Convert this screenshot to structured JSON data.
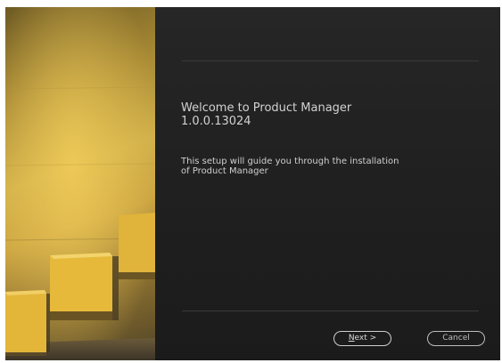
{
  "installer": {
    "welcome_title": "Welcome to Product Manager",
    "version": "1.0.0.13024",
    "description_line1": "This setup will guide you through the installation",
    "description_line2": "of Product Manager"
  },
  "buttons": {
    "next": {
      "mnemonic": "N",
      "rest": "ext >"
    },
    "cancel": "Cancel"
  },
  "colors": {
    "panel_background": "#212121",
    "text": "#d2d2d2",
    "button_border": "#cfcfcf",
    "hero_yellow": "#e5b93b"
  }
}
